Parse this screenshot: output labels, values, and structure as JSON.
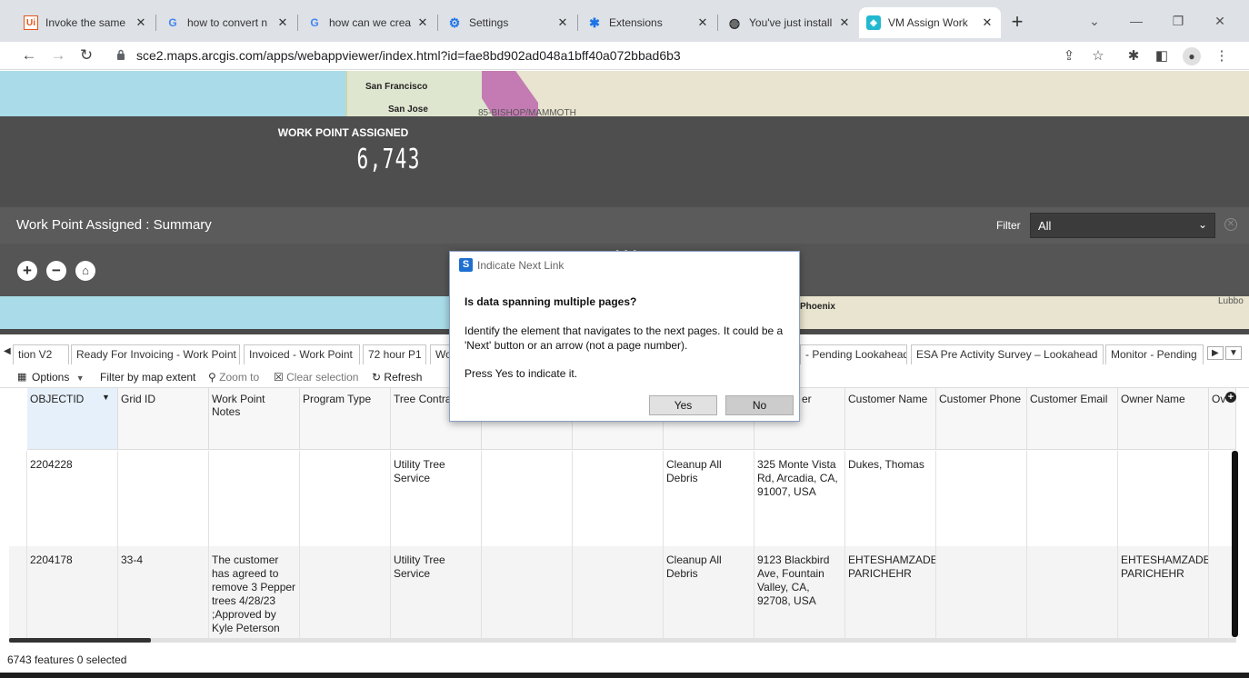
{
  "browser": {
    "tabs": [
      {
        "title": "Invoke the same",
        "icon": "uipath-icon",
        "active": false
      },
      {
        "title": "how to convert n",
        "icon": "google-icon",
        "active": false
      },
      {
        "title": "how can we crea",
        "icon": "google-icon",
        "active": false
      },
      {
        "title": "Settings",
        "icon": "gear-icon",
        "active": false
      },
      {
        "title": "Extensions",
        "icon": "puzzle-icon",
        "active": false
      },
      {
        "title": "You've just install",
        "icon": "globe-icon",
        "active": false
      },
      {
        "title": "VM Assign Work",
        "icon": "app-icon",
        "active": true
      }
    ],
    "url": "sce2.maps.arcgis.com/apps/webappviewer/index.html?id=fae8bd902ad048a1bff40a072bbad6b3"
  },
  "map": {
    "labels": [
      "San Francisco",
      "San Jose",
      "85-BISHOP/MAMMOTH",
      "Phoenix",
      "Lubbo"
    ]
  },
  "kpi": {
    "title": "WORK POINT ASSIGNED",
    "value": "6,743"
  },
  "summary": {
    "title": "Work Point Assigned : Summary",
    "filter_label": "Filter",
    "filter_value": "All"
  },
  "table_tabs": [
    "tion V2",
    "Ready For Invoicing - Work Point",
    "Invoiced - Work Point",
    "72 hour P1",
    "Wo",
    "- Pending Lookahead",
    "ESA Pre Activity Survey – Lookahead",
    "Monitor - Pending"
  ],
  "table_toolbar": {
    "options": "Options",
    "filter_extent": "Filter by map extent",
    "zoom_to": "Zoom to",
    "clear_selection": "Clear selection",
    "refresh": "Refresh"
  },
  "columns": [
    "OBJECTID",
    "Grid ID",
    "Work Point Notes",
    "Program Type",
    "Tree Contra",
    "",
    "",
    "",
    "er",
    "Customer Name",
    "Customer Phone",
    "Customer Email",
    "Owner Name",
    "Ov"
  ],
  "rows": [
    {
      "objectid": "2204228",
      "grid_id": "",
      "notes": "",
      "program_type": "",
      "tree_contractor": "Utility Tree Service",
      "work_type": "Cleanup All Debris",
      "address": "325 Monte Vista Rd, Arcadia, CA, 91007, USA",
      "customer_name": "Dukes, Thomas",
      "customer_phone": "",
      "customer_email": "",
      "owner_name": ""
    },
    {
      "objectid": "2204178",
      "grid_id": "33-4",
      "notes": "The customer has agreed to remove 3 Pepper trees 4/28/23 ;Approved by Kyle Peterson",
      "program_type": "",
      "tree_contractor": "Utility Tree Service",
      "work_type": "Cleanup All Debris",
      "address": "9123 Blackbird Ave, Fountain Valley, CA, 92708, USA",
      "customer_name": "EHTESHAMZADE PARICHEHR",
      "customer_phone": "",
      "customer_email": "",
      "owner_name": "EHTESHAMZADE PARICHEHR"
    }
  ],
  "status": "6743 features  0 selected",
  "dialog": {
    "title": "Indicate Next Link",
    "heading": "Is data spanning multiple pages?",
    "body": "Identify the element that navigates to the next pages. It could be a 'Next' button or an arrow (not a page number).",
    "prompt": "Press Yes to indicate it.",
    "yes": "Yes",
    "no": "No"
  },
  "colors": {
    "kpi_bg": "#4e4e4e",
    "summary_bg": "#5b5b5b",
    "dialog_border": "#8aa1c1",
    "accent_blue": "#1e6fd0"
  }
}
